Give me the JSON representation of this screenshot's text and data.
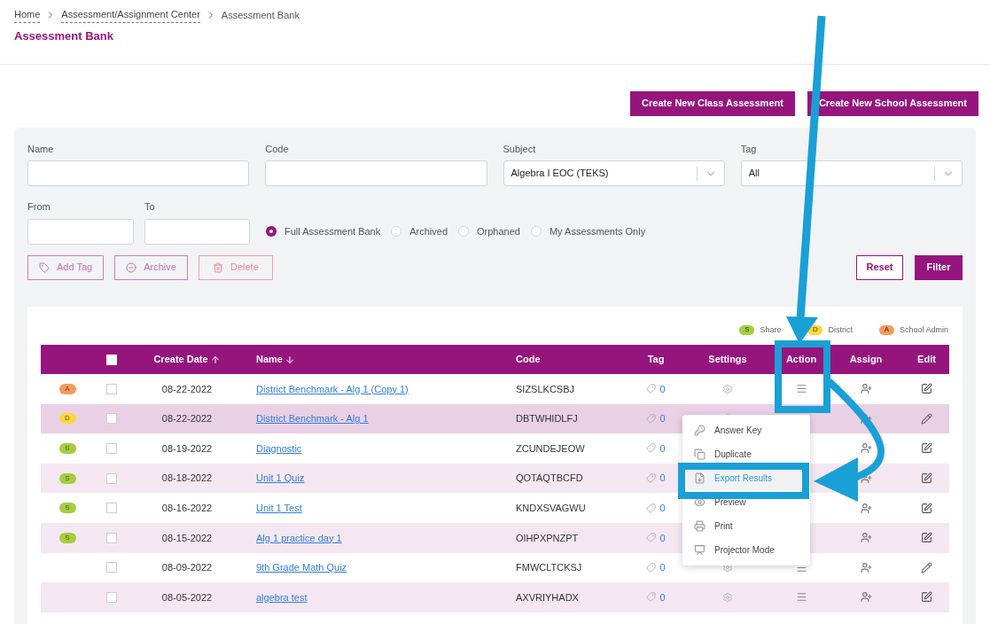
{
  "breadcrumb": [
    {
      "label": "Home",
      "link": true
    },
    {
      "label": "Assessment/Assignment Center",
      "link": true
    },
    {
      "label": "Assessment Bank",
      "link": false
    }
  ],
  "page_title": "Assessment Bank",
  "top_buttons": [
    "Create New Class Assessment",
    "Create New School Assessment"
  ],
  "filters": {
    "name": {
      "label": "Name"
    },
    "code": {
      "label": "Code"
    },
    "subject": {
      "label": "Subject",
      "value": "Algebra I EOC (TEKS)"
    },
    "tag": {
      "label": "Tag",
      "value": "All"
    },
    "from": {
      "label": "From"
    },
    "to": {
      "label": "To"
    }
  },
  "scope_options": [
    {
      "label": "Full Assessment Bank",
      "selected": true
    },
    {
      "label": "Archived",
      "selected": false
    },
    {
      "label": "Orphaned",
      "selected": false
    },
    {
      "label": "My Assessments Only",
      "selected": false
    }
  ],
  "bulk_buttons": [
    {
      "kind": "tag",
      "label": "Add Tag"
    },
    {
      "kind": "archive",
      "label": "Archive"
    },
    {
      "kind": "delete",
      "label": "Delete"
    }
  ],
  "filter_buttons": {
    "reset": "Reset",
    "filter": "Filter"
  },
  "legend": [
    {
      "letter": "S",
      "label": "Share",
      "color": "#a3cf3b"
    },
    {
      "letter": "D",
      "label": "District",
      "color": "#fcd835"
    },
    {
      "letter": "A",
      "label": "School Admin",
      "color": "#f59b5a"
    }
  ],
  "table": {
    "select_all_checked": false,
    "columns": [
      {
        "label": "Create Date",
        "kind": "sort_asc"
      },
      {
        "label": "Name",
        "kind": "sort_desc"
      },
      {
        "label": "Code"
      },
      {
        "label": "Tag"
      },
      {
        "label": "Settings"
      },
      {
        "label": "Action"
      },
      {
        "label": "Assign"
      },
      {
        "label": "Edit"
      }
    ],
    "rows": [
      {
        "badge": "A",
        "color": "#f59b5a",
        "checked": false,
        "highlighted": false,
        "date": "08-22-2022",
        "name": "District Benchmark - Alg 1 (Copy 1)",
        "code": "SIZSLKCSBJ",
        "tags": "0",
        "kind": "square"
      },
      {
        "badge": "D",
        "color": "#fcd835",
        "checked": false,
        "highlighted": true,
        "date": "08-22-2022",
        "name": "District Benchmark - Alg 1",
        "code": "DBTWHIDLFJ",
        "tags": "0",
        "kind": "pencil"
      },
      {
        "badge": "S",
        "color": "#a3cf3b",
        "checked": false,
        "highlighted": false,
        "date": "08-19-2022",
        "name": "Diagnostic",
        "code": "ZCUNDEJEOW",
        "tags": "0",
        "kind": "square"
      },
      {
        "badge": "S",
        "color": "#a3cf3b",
        "checked": false,
        "highlighted": false,
        "date": "08-18-2022",
        "name": "Unit 1 Quiz",
        "code": "QOTAQTBCFD",
        "tags": "0",
        "kind": "square"
      },
      {
        "badge": "S",
        "color": "#a3cf3b",
        "checked": false,
        "highlighted": false,
        "date": "08-16-2022",
        "name": "Unit 1 Test",
        "code": "KNDXSVAGWU",
        "tags": "0",
        "kind": "square"
      },
      {
        "badge": "S",
        "color": "#a3cf3b",
        "checked": false,
        "highlighted": false,
        "date": "08-15-2022",
        "name": "Alg 1 practice day 1",
        "code": "OIHPXPNZPT",
        "tags": "0",
        "kind": "square"
      },
      {
        "checked": false,
        "highlighted": false,
        "date": "08-09-2022",
        "name": "9th Grade Math Quiz",
        "code": "FMWCLTCKSJ",
        "tags": "0",
        "kind": "pencil"
      },
      {
        "checked": false,
        "highlighted": false,
        "date": "08-05-2022",
        "name": "algebra test",
        "code": "AXVRIYHADX",
        "tags": "0",
        "kind": "square"
      }
    ]
  },
  "action_menu": [
    {
      "kind": "key",
      "label": "Answer Key",
      "selected": false
    },
    {
      "kind": "duplicate",
      "label": "Duplicate",
      "selected": false
    },
    {
      "kind": "export",
      "label": "Export Results",
      "selected": true
    },
    {
      "kind": "preview",
      "label": "Preview",
      "selected": false
    },
    {
      "kind": "print",
      "label": "Print",
      "selected": false
    },
    {
      "kind": "projector",
      "label": "Projector Mode",
      "selected": false
    }
  ]
}
